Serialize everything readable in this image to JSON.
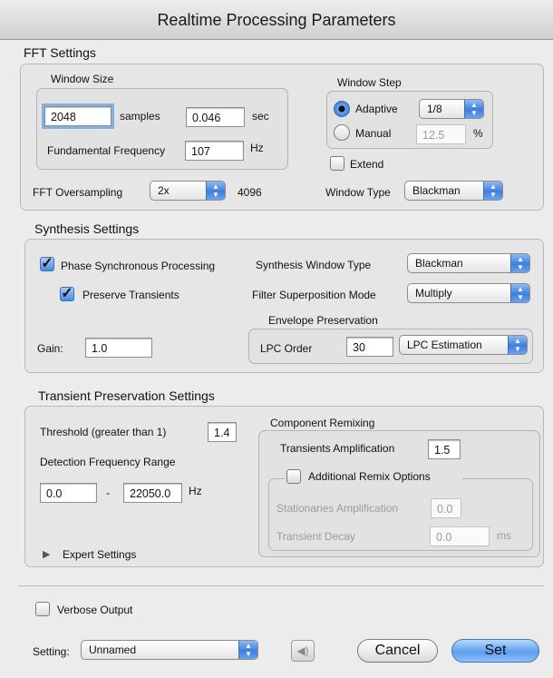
{
  "window": {
    "title": "Realtime Processing Parameters"
  },
  "fft": {
    "title": "FFT Settings",
    "window_size": {
      "title": "Window Size",
      "samples_value": "2048",
      "samples_label": "samples",
      "sec_value": "0.046",
      "sec_label": "sec",
      "fund_label": "Fundamental Frequency",
      "fund_value": "107",
      "hz_label": "Hz"
    },
    "window_step": {
      "title": "Window Step",
      "adaptive_label": "Adaptive",
      "adaptive_value": "1/8",
      "manual_label": "Manual",
      "manual_value": "12.5",
      "pct_label": "%",
      "extend_label": "Extend",
      "selected": "adaptive"
    },
    "oversampling_label": "FFT Oversampling",
    "oversampling_value": "2x",
    "oversampling_result": "4096",
    "window_type_label": "Window Type",
    "window_type_value": "Blackman"
  },
  "synthesis": {
    "title": "Synthesis Settings",
    "phase_sync_label": "Phase Synchronous Processing",
    "phase_sync_checked": true,
    "preserve_transients_label": "Preserve Transients",
    "preserve_transients_checked": true,
    "synth_window_label": "Synthesis Window Type",
    "synth_window_value": "Blackman",
    "filter_mode_label": "Filter Superposition Mode",
    "filter_mode_value": "Multiply",
    "envelope_title": "Envelope Preservation",
    "lpc_order_label": "LPC Order",
    "lpc_order_value": "30",
    "lpc_method_value": "LPC Estimation",
    "gain_label": "Gain:",
    "gain_value": "1.0"
  },
  "transient": {
    "title": "Transient Preservation Settings",
    "threshold_label": "Threshold (greater than 1)",
    "threshold_value": "1.4",
    "detection_label": "Detection Frequency Range",
    "range_min": "0.0",
    "range_dash": "-",
    "range_max": "22050.0",
    "range_unit": "Hz",
    "expert_label": "Expert Settings",
    "remix": {
      "title": "Component Remixing",
      "trans_amp_label": "Transients Amplification",
      "trans_amp_value": "1.5",
      "additional_label": "Additional Remix Options",
      "stat_amp_label": "Stationaries Amplification",
      "stat_amp_value": "0.0",
      "decay_label": "Transient Decay",
      "decay_value": "0.0",
      "decay_unit": "ms"
    }
  },
  "footer": {
    "verbose_label": "Verbose Output",
    "setting_label": "Setting:",
    "setting_value": "Unnamed",
    "cancel_label": "Cancel",
    "set_label": "Set"
  },
  "icons": {
    "popup_arrows": "up-down-arrows-icon",
    "speaker": "speaker-icon",
    "disclosure": "disclosure-triangle-icon",
    "checkmark": "checkmark-icon"
  }
}
